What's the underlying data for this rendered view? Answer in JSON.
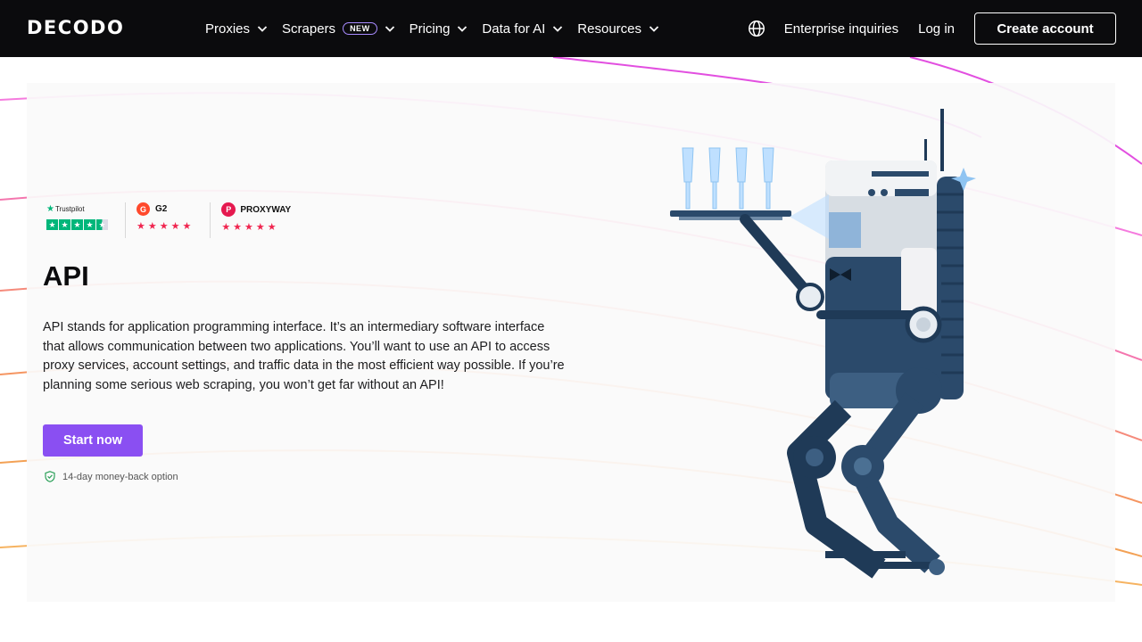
{
  "header": {
    "logo": "DECODO",
    "nav": [
      {
        "label": "Proxies"
      },
      {
        "label": "Scrapers",
        "badge": "NEW"
      },
      {
        "label": "Pricing"
      },
      {
        "label": "Data for AI"
      },
      {
        "label": "Resources"
      }
    ],
    "enterprise_label": "Enterprise inquiries",
    "login_label": "Log in",
    "create_account_label": "Create account"
  },
  "ratings": {
    "trustpilot_label": "Trustpilot",
    "g2_label": "G2",
    "proxyway_label": "PROXYWAY",
    "star_rating": 4.5
  },
  "hero": {
    "title": "API",
    "description": "API stands for application programming interface. It’s an intermediary software interface that allows communication between two applications. You’ll want to use an API to access proxy services, account settings, and traffic data in the most efficient way possible. If you’re planning some serious web scraping, you won’t get far without an API!",
    "cta_label": "Start now",
    "guarantee": "14-day money-back option"
  },
  "colors": {
    "header_bg": "#0b0b0d",
    "accent": "#8a4ff2",
    "trustpilot_green": "#00b67a",
    "star_red": "#f0254f"
  },
  "icons": [
    "globe-icon",
    "chevron-down-icon",
    "shield-check-icon",
    "trustpilot-star-icon",
    "g2-icon",
    "proxyway-icon"
  ]
}
